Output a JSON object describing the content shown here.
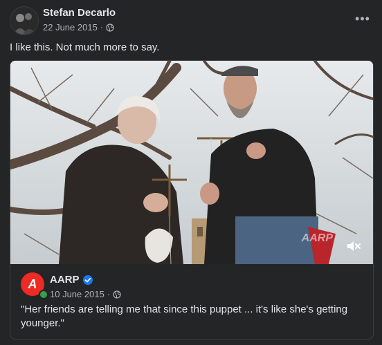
{
  "post": {
    "author": "Stefan Decarlo",
    "date": "22 June 2015",
    "separator": "·",
    "privacy_icon": "globe-icon",
    "more_icon": "more-options-icon",
    "more_label": "•••",
    "text": "I like this. Not much more to say."
  },
  "shared_post": {
    "video": {
      "watermark": "AARP",
      "mute_icon": "muted-speaker-icon"
    },
    "author": "AARP",
    "avatar_letter": "A",
    "verified_icon": "verified-badge-icon",
    "date": "10 June 2015",
    "separator": "·",
    "privacy_icon": "globe-icon",
    "text": "\"Her friends are telling me that since this puppet ... it's like she's getting younger.\""
  },
  "colors": {
    "background": "#242526",
    "text_primary": "#e4e6eb",
    "text_secondary": "#b0b3b8",
    "brand_red": "#ee2a24",
    "verified_blue": "#1877f2",
    "online_green": "#31a24c"
  }
}
